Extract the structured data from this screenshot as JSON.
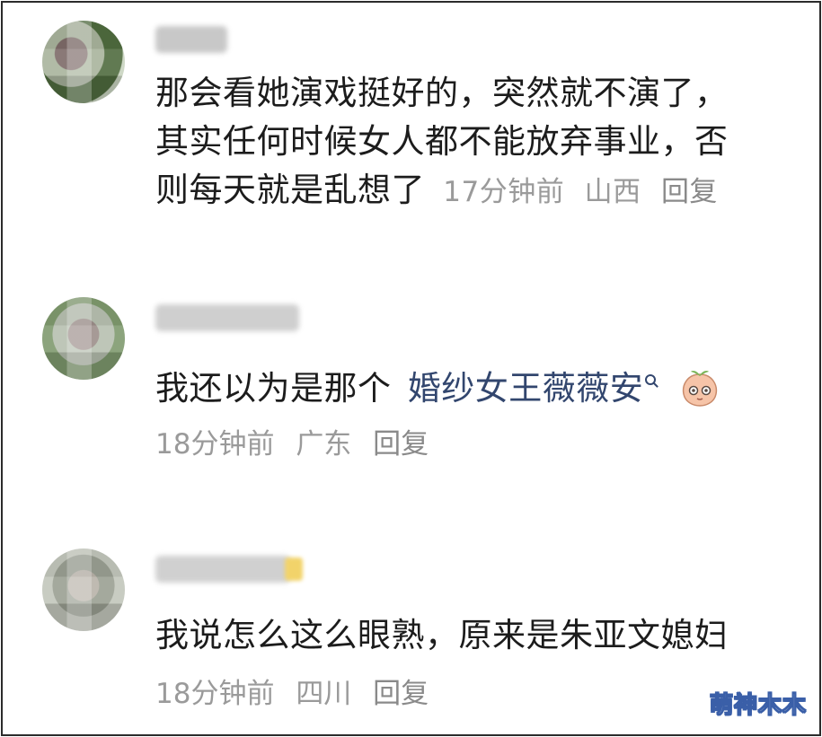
{
  "comments": [
    {
      "lines": [
        "那会看她演戏挺好的，突然就不演了，",
        "其实任何时候女人都不能放弃事业，否",
        "则每天就是乱想了"
      ],
      "time": "17分钟前",
      "location": "山西",
      "reply": "回复"
    },
    {
      "text": "我还以为是那个",
      "link": "婚纱女王薇薇安",
      "time": "18分钟前",
      "location": "广东",
      "reply": "回复"
    },
    {
      "text": "我说怎么这么眼熟，原来是朱亚文媳妇",
      "time": "18分钟前",
      "location": "四川",
      "reply": "回复"
    }
  ],
  "watermark": "萌神木木",
  "icons": [
    "search-icon",
    "peach-emoji-icon"
  ]
}
